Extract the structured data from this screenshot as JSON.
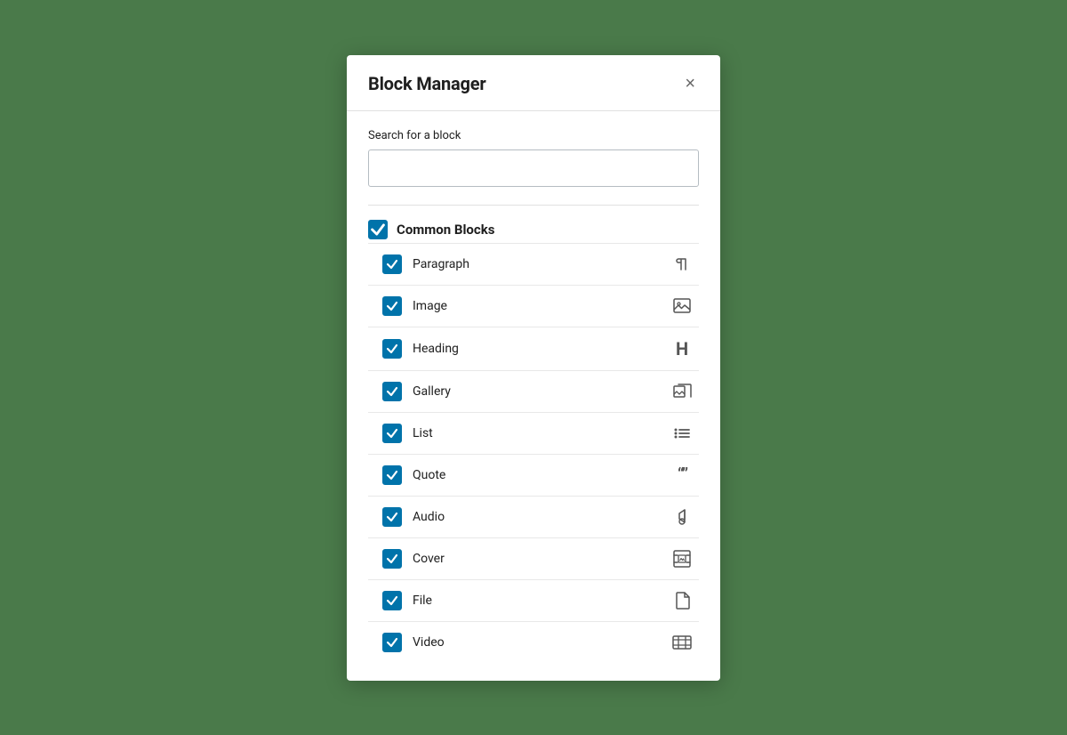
{
  "modal": {
    "title": "Block Manager",
    "close_label": "×",
    "search": {
      "label": "Search for a block",
      "placeholder": ""
    },
    "sections": [
      {
        "id": "common-blocks",
        "title": "Common Blocks",
        "checked": true,
        "blocks": [
          {
            "id": "paragraph",
            "name": "Paragraph",
            "icon": "¶",
            "icon_type": "paragraph",
            "checked": true
          },
          {
            "id": "image",
            "name": "Image",
            "icon": "image",
            "icon_type": "image",
            "checked": true
          },
          {
            "id": "heading",
            "name": "Heading",
            "icon": "H",
            "icon_type": "heading",
            "checked": true
          },
          {
            "id": "gallery",
            "name": "Gallery",
            "icon": "gallery",
            "icon_type": "gallery",
            "checked": true
          },
          {
            "id": "list",
            "name": "List",
            "icon": "list",
            "icon_type": "list",
            "checked": true
          },
          {
            "id": "quote",
            "name": "Quote",
            "icon": "quote",
            "icon_type": "quote",
            "checked": true
          },
          {
            "id": "audio",
            "name": "Audio",
            "icon": "audio",
            "icon_type": "audio",
            "checked": true
          },
          {
            "id": "cover",
            "name": "Cover",
            "icon": "cover",
            "icon_type": "cover",
            "checked": true
          },
          {
            "id": "file",
            "name": "File",
            "icon": "file",
            "icon_type": "file",
            "checked": true
          },
          {
            "id": "video",
            "name": "Video",
            "icon": "video",
            "icon_type": "video",
            "checked": true
          }
        ]
      }
    ]
  }
}
